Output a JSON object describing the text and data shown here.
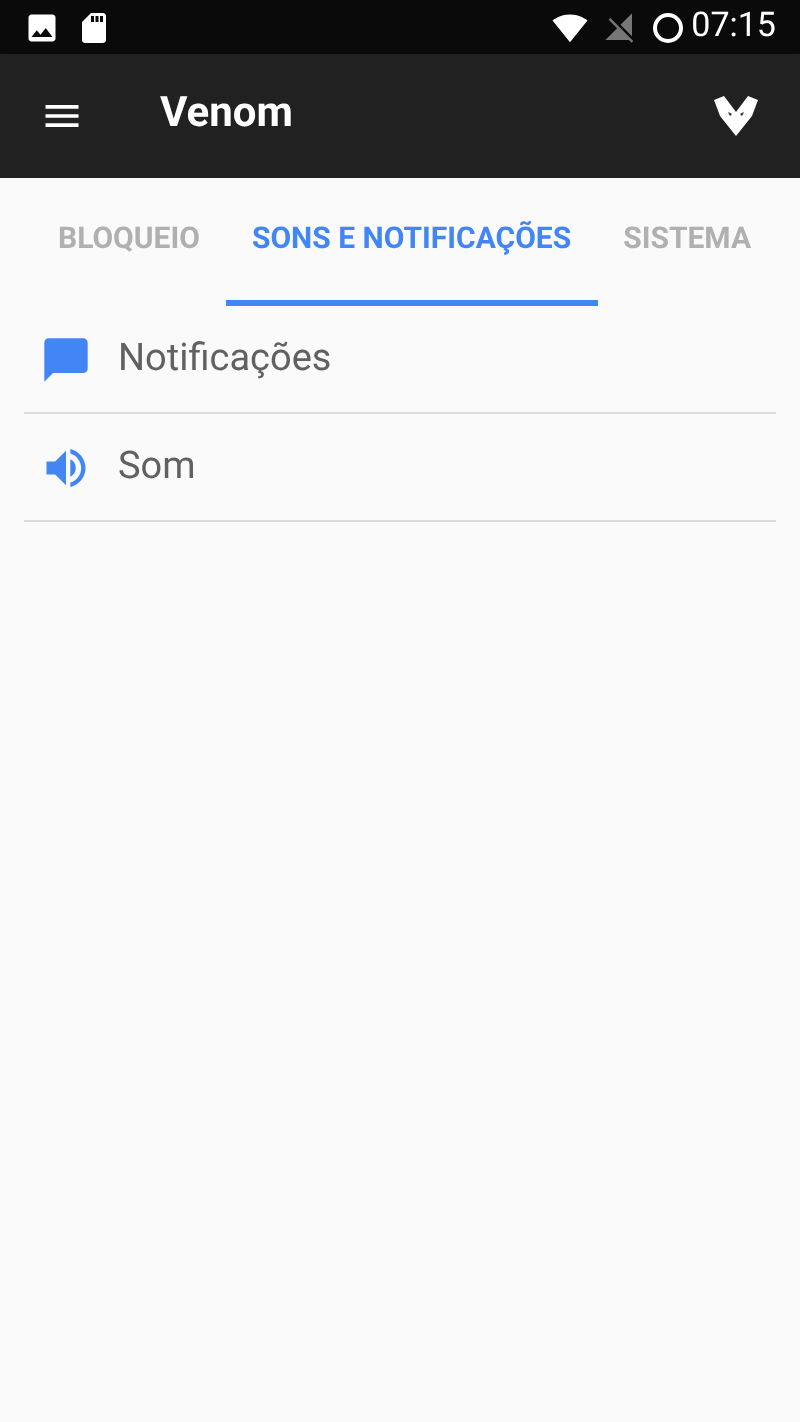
{
  "status_bar": {
    "time": "07:15"
  },
  "toolbar": {
    "title": "Venom"
  },
  "tabs": [
    {
      "label": "BLOQUEIO",
      "selected": false
    },
    {
      "label": "SONS E NOTIFICAÇÕES",
      "selected": true
    },
    {
      "label": "SISTEMA",
      "selected": false
    }
  ],
  "items": [
    {
      "label": "Notificações"
    },
    {
      "label": "Som"
    }
  ]
}
